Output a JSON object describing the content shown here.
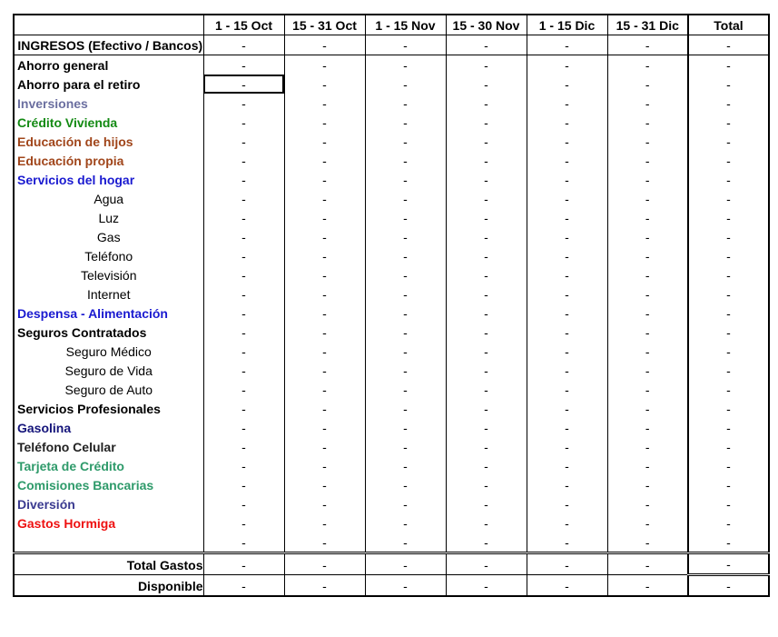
{
  "header": {
    "columns": [
      "1 - 15 Oct",
      "15 - 31 Oct",
      "1 - 15 Nov",
      "15 - 30 Nov",
      "1 - 15 Dic",
      "15 - 31 Dic",
      "Total"
    ]
  },
  "income_row": {
    "label": "INGRESOS (Efectivo / Bancos)",
    "values": [
      "-",
      "-",
      "-",
      "-",
      "-",
      "-",
      "-"
    ]
  },
  "colors": {
    "black": "#000000",
    "inversiones": "#6B6FA0",
    "credito_vivienda": "#138A13",
    "educacion": "#A0451A",
    "servicios_hogar": "#1A1AD0",
    "gasolina": "#14147A",
    "tarjeta": "#2E9A6A",
    "diversion": "#3A3A90",
    "gastos_hormiga": "#EE1111"
  },
  "rows": [
    {
      "label": "Ahorro general",
      "style": "bold",
      "color": "#000000",
      "values": [
        "-",
        "-",
        "-",
        "-",
        "-",
        "-",
        "-"
      ]
    },
    {
      "label": "Ahorro para el retiro",
      "style": "bold",
      "color": "#000000",
      "values": [
        "-",
        "-",
        "-",
        "-",
        "-",
        "-",
        "-"
      ],
      "selected_col": 0
    },
    {
      "label": "Inversiones",
      "style": "bold",
      "color": "#6B6FA0",
      "values": [
        "-",
        "-",
        "-",
        "-",
        "-",
        "-",
        "-"
      ]
    },
    {
      "label": "Crédito Vivienda",
      "style": "bold",
      "color": "#138A13",
      "values": [
        "-",
        "-",
        "-",
        "-",
        "-",
        "-",
        "-"
      ]
    },
    {
      "label": "Educación de hijos",
      "style": "bold",
      "color": "#A0451A",
      "values": [
        "-",
        "-",
        "-",
        "-",
        "-",
        "-",
        "-"
      ]
    },
    {
      "label": "Educación propia",
      "style": "bold",
      "color": "#A0451A",
      "values": [
        "-",
        "-",
        "-",
        "-",
        "-",
        "-",
        "-"
      ]
    },
    {
      "label": "Servicios del hogar",
      "style": "bold",
      "color": "#1A1AD0",
      "values": [
        "-",
        "-",
        "-",
        "-",
        "-",
        "-",
        "-"
      ]
    },
    {
      "label": "Agua",
      "style": "sub",
      "color": "#000000",
      "values": [
        "-",
        "-",
        "-",
        "-",
        "-",
        "-",
        "-"
      ]
    },
    {
      "label": "Luz",
      "style": "sub",
      "color": "#000000",
      "values": [
        "-",
        "-",
        "-",
        "-",
        "-",
        "-",
        "-"
      ]
    },
    {
      "label": "Gas",
      "style": "sub",
      "color": "#000000",
      "values": [
        "-",
        "-",
        "-",
        "-",
        "-",
        "-",
        "-"
      ]
    },
    {
      "label": "Teléfono",
      "style": "sub",
      "color": "#000000",
      "values": [
        "-",
        "-",
        "-",
        "-",
        "-",
        "-",
        "-"
      ]
    },
    {
      "label": "Televisión",
      "style": "sub",
      "color": "#000000",
      "values": [
        "-",
        "-",
        "-",
        "-",
        "-",
        "-",
        "-"
      ]
    },
    {
      "label": "Internet",
      "style": "sub",
      "color": "#000000",
      "values": [
        "-",
        "-",
        "-",
        "-",
        "-",
        "-",
        "-"
      ]
    },
    {
      "label": "Despensa - Alimentación",
      "style": "bold",
      "color": "#1A1AD0",
      "values": [
        "-",
        "-",
        "-",
        "-",
        "-",
        "-",
        "-"
      ]
    },
    {
      "label": "Seguros Contratados",
      "style": "bold",
      "color": "#000000",
      "values": [
        "-",
        "-",
        "-",
        "-",
        "-",
        "-",
        "-"
      ]
    },
    {
      "label": "Seguro Médico",
      "style": "sub",
      "color": "#000000",
      "values": [
        "-",
        "-",
        "-",
        "-",
        "-",
        "-",
        "-"
      ]
    },
    {
      "label": "Seguro de Vida",
      "style": "sub",
      "color": "#000000",
      "values": [
        "-",
        "-",
        "-",
        "-",
        "-",
        "-",
        "-"
      ]
    },
    {
      "label": "Seguro de Auto",
      "style": "sub",
      "color": "#000000",
      "values": [
        "-",
        "-",
        "-",
        "-",
        "-",
        "-",
        "-"
      ]
    },
    {
      "label": "Servicios Profesionales",
      "style": "bold",
      "color": "#000000",
      "values": [
        "-",
        "-",
        "-",
        "-",
        "-",
        "-",
        "-"
      ]
    },
    {
      "label": "Gasolina",
      "style": "bold",
      "color": "#14147A",
      "values": [
        "-",
        "-",
        "-",
        "-",
        "-",
        "-",
        "-"
      ]
    },
    {
      "label": "Teléfono Celular",
      "style": "bold",
      "color": "#222222",
      "values": [
        "-",
        "-",
        "-",
        "-",
        "-",
        "-",
        "-"
      ]
    },
    {
      "label": "Tarjeta de Crédito",
      "style": "bold",
      "color": "#2E9A6A",
      "values": [
        "-",
        "-",
        "-",
        "-",
        "-",
        "-",
        "-"
      ]
    },
    {
      "label": "Comisiones Bancarias",
      "style": "bold",
      "color": "#2E9A6A",
      "values": [
        "-",
        "-",
        "-",
        "-",
        "-",
        "-",
        "-"
      ]
    },
    {
      "label": "Diversión",
      "style": "bold",
      "color": "#3A3A90",
      "values": [
        "-",
        "-",
        "-",
        "-",
        "-",
        "-",
        "-"
      ]
    },
    {
      "label": "Gastos Hormiga",
      "style": "bold",
      "color": "#EE1111",
      "values": [
        "-",
        "-",
        "-",
        "-",
        "-",
        "-",
        "-"
      ]
    },
    {
      "label": "",
      "style": "bold",
      "color": "#000000",
      "values": [
        "-",
        "-",
        "-",
        "-",
        "-",
        "-",
        "-"
      ]
    }
  ],
  "totals": [
    {
      "label": "Total Gastos",
      "values": [
        "-",
        "-",
        "-",
        "-",
        "-",
        "-",
        "-"
      ]
    },
    {
      "label": "Disponible",
      "values": [
        "-",
        "-",
        "-",
        "-",
        "-",
        "-",
        "-"
      ]
    }
  ]
}
